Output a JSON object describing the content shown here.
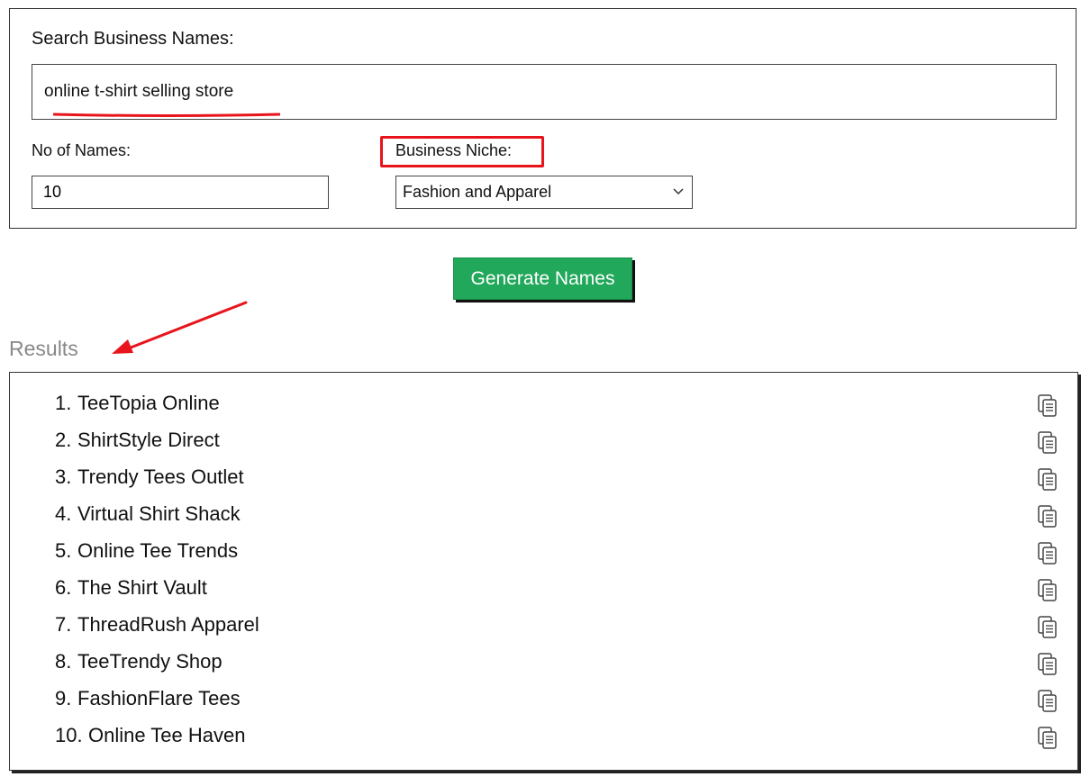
{
  "form": {
    "search_label": "Search Business Names:",
    "search_value": "online t-shirt selling store",
    "count_label": "No of Names:",
    "count_value": "10",
    "niche_label": "Business Niche:",
    "niche_value": "Fashion and Apparel"
  },
  "generate_label": "Generate Names",
  "results": {
    "heading": "Results",
    "items": [
      {
        "num": "1.",
        "name": "TeeTopia Online"
      },
      {
        "num": "2.",
        "name": "ShirtStyle Direct"
      },
      {
        "num": "3.",
        "name": "Trendy Tees Outlet"
      },
      {
        "num": "4.",
        "name": "Virtual Shirt Shack"
      },
      {
        "num": "5.",
        "name": "Online Tee Trends"
      },
      {
        "num": "6.",
        "name": "The Shirt Vault"
      },
      {
        "num": "7.",
        "name": "ThreadRush Apparel"
      },
      {
        "num": "8.",
        "name": "TeeTrendy Shop"
      },
      {
        "num": "9.",
        "name": "FashionFlare Tees"
      },
      {
        "num": "10.",
        "name": "Online Tee Haven"
      }
    ]
  },
  "icons": {
    "copy": "copy-icon",
    "dropdown": "chevron-down-icon"
  },
  "colors": {
    "button": "#21a85a",
    "annotation": "#e8141b",
    "results_heading": "#888888"
  }
}
